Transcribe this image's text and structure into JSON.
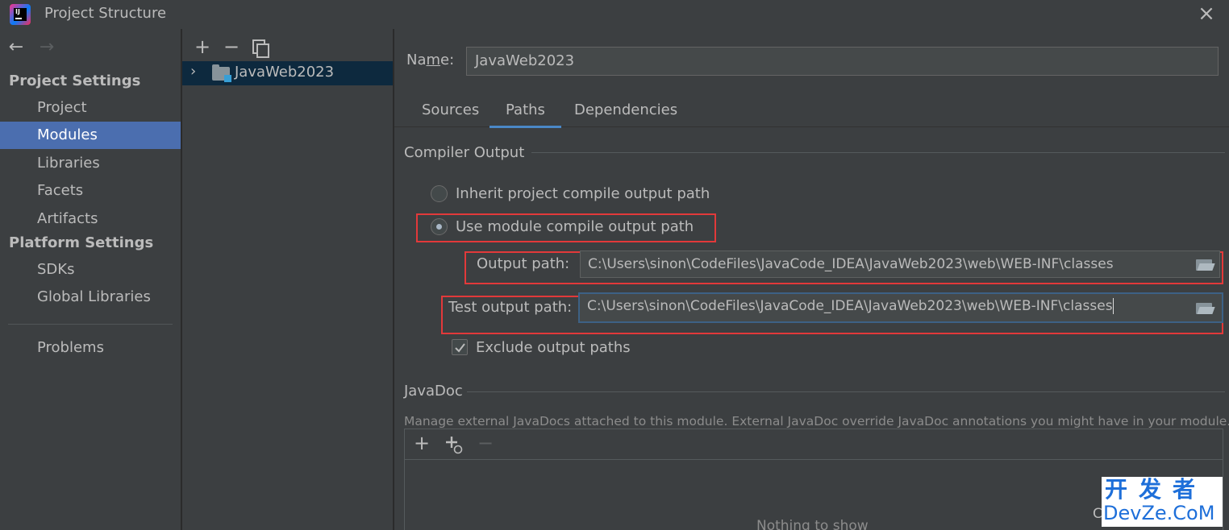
{
  "window": {
    "title": "Project Structure"
  },
  "sidebar": {
    "project_settings_heading": "Project Settings",
    "project_items": [
      "Project",
      "Modules",
      "Libraries",
      "Facets",
      "Artifacts"
    ],
    "selected": "Modules",
    "platform_settings_heading": "Platform Settings",
    "platform_items": [
      "SDKs",
      "Global Libraries"
    ],
    "problems": "Problems"
  },
  "module_tree": {
    "items": [
      "JavaWeb2023"
    ]
  },
  "module": {
    "name_label_prefix": "Na",
    "name_label_mnemonic": "m",
    "name_label_suffix": "e:",
    "name_value": "JavaWeb2023"
  },
  "tabs": [
    "Sources",
    "Paths",
    "Dependencies"
  ],
  "selected_tab": "Paths",
  "compiler_output": {
    "title": "Compiler Output",
    "inherit_label": "Inherit project compile output path",
    "use_module_label": "Use module compile output path",
    "selected_option": "use_module",
    "output_path_label": "Output path:",
    "output_path_value": "C:\\Users\\sinon\\CodeFiles\\JavaCode_IDEA\\JavaWeb2023\\web\\WEB-INF\\classes",
    "test_output_path_label": "Test output path:",
    "test_output_path_value": "C:\\Users\\sinon\\CodeFiles\\JavaCode_IDEA\\JavaWeb2023\\web\\WEB-INF\\classes",
    "exclude_label": "Exclude output paths",
    "exclude_checked": true
  },
  "javadoc": {
    "title": "JavaDoc",
    "description": "Manage external JavaDocs attached to this module. External JavaDoc override JavaDoc annotations you might have in your module.",
    "empty_text": "Nothing to show"
  },
  "watermark": {
    "cn": "开发者",
    "en": "DevZe.CoM",
    "stray": "C"
  },
  "colors": {
    "accent": "#4b6eaf",
    "highlight": "#e2393a",
    "tab_underline": "#4a88c7",
    "watermark": "#1e6fd9"
  }
}
